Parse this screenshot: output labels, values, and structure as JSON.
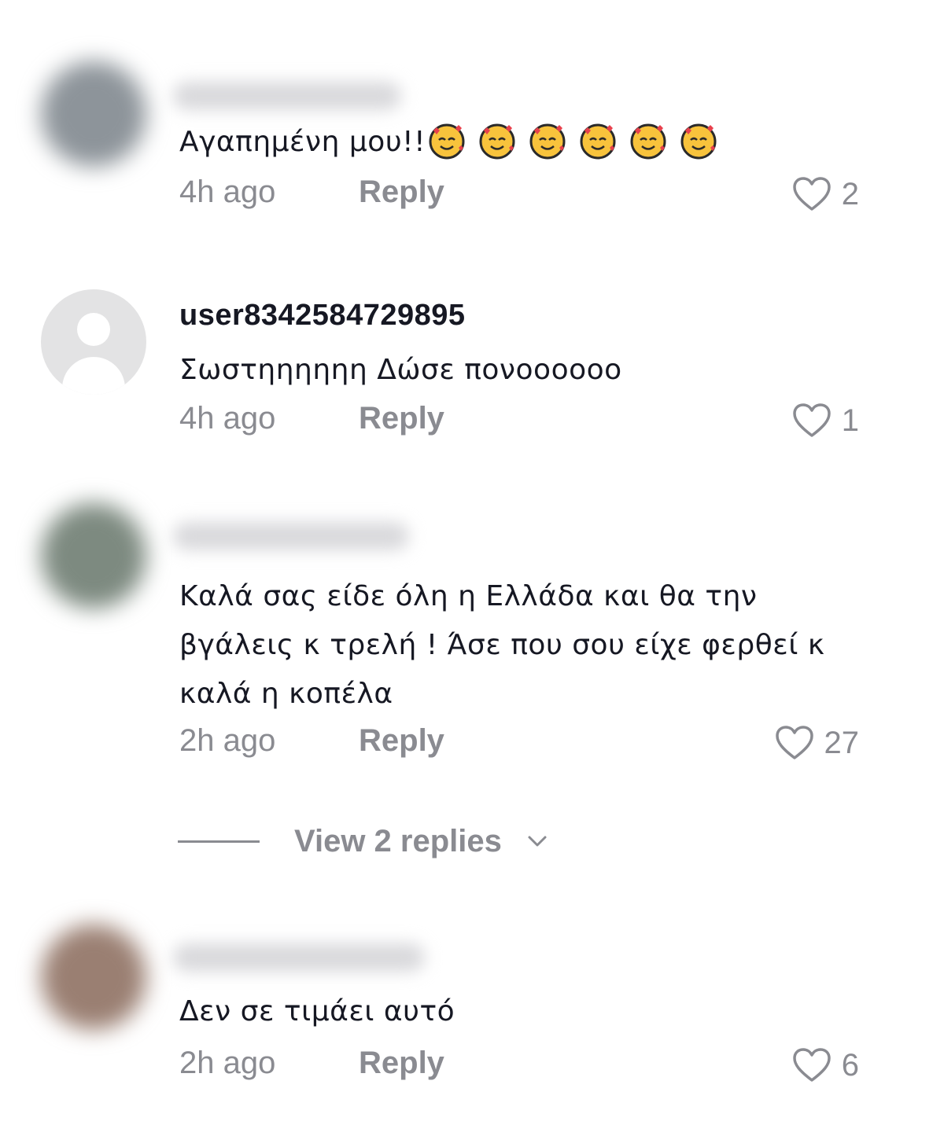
{
  "comments": [
    {
      "username": "",
      "text": "Αγαπημένη μου!!",
      "emojis": [
        "smiling-face-with-hearts",
        "smiling-face-with-hearts",
        "smiling-face-with-hearts",
        "smiling-face-with-hearts",
        "smiling-face-with-hearts",
        "smiling-face-with-hearts"
      ],
      "time": "4h ago",
      "reply_label": "Reply",
      "likes": "2",
      "avatar": "blurred"
    },
    {
      "username": "user8342584729895",
      "text": "Σωστηηηηηη Δώσε πονοοοοοο",
      "time": "4h ago",
      "reply_label": "Reply",
      "likes": "1",
      "avatar": "default"
    },
    {
      "username": "",
      "text": "Καλά σας είδε όλη η Ελλάδα και θα την βγάλεις κ τρελή ! Άσε που σου είχε φερθεί κ καλά η κοπέλα",
      "time": "2h ago",
      "reply_label": "Reply",
      "likes": "27",
      "avatar": "blurred"
    },
    {
      "username": "",
      "text": "Δεν σε τιμάει αυτό",
      "time": "2h ago",
      "reply_label": "Reply",
      "likes": "6",
      "avatar": "blurred"
    }
  ],
  "view_replies": {
    "label": "View 2 replies"
  },
  "colors": {
    "text": "#161823",
    "muted": "#8a8b91",
    "avatar_default_bg": "#e3e3e4",
    "avatar_1": "#8d949a",
    "avatar_3": "#7d8a80",
    "avatar_4": "#9a7f72",
    "emoji_face": "#f8c33c",
    "emoji_heart": "#e8404c"
  }
}
